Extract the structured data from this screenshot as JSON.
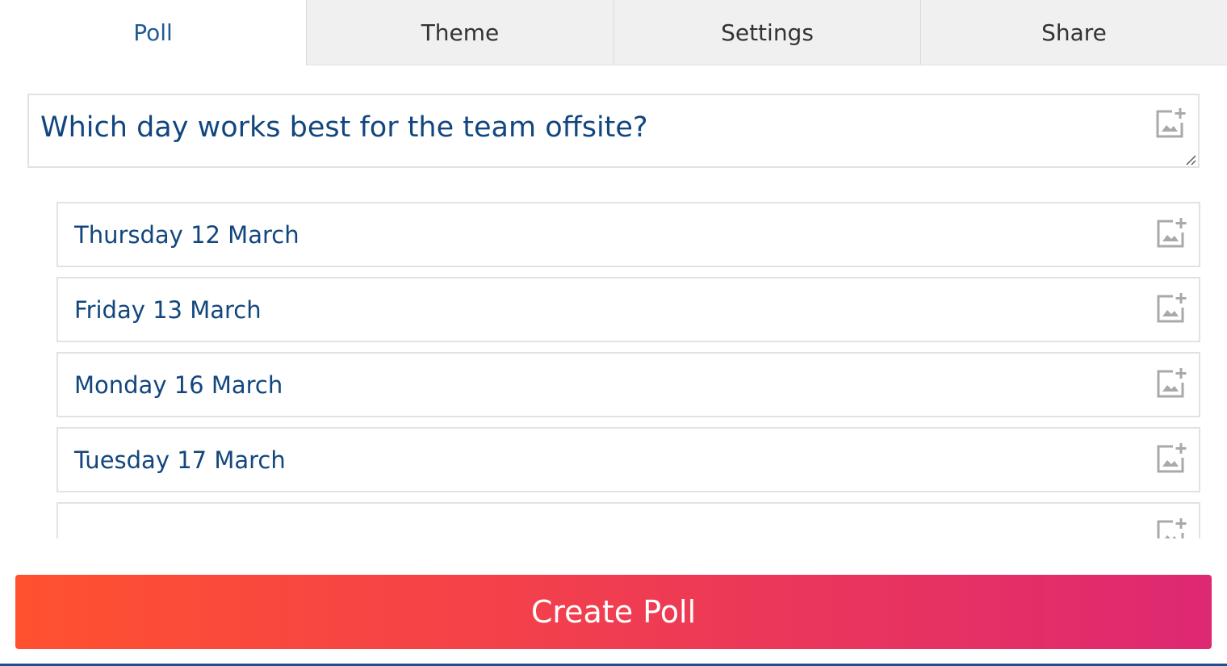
{
  "tabs": [
    {
      "label": "Poll",
      "active": true
    },
    {
      "label": "Theme",
      "active": false
    },
    {
      "label": "Settings",
      "active": false
    },
    {
      "label": "Share",
      "active": false
    }
  ],
  "question": {
    "text": "Which day works best for the team offsite?",
    "image_icon": "add-image-icon"
  },
  "options": [
    {
      "text": "Thursday 12 March"
    },
    {
      "text": "Friday 13 March"
    },
    {
      "text": "Monday 16 March"
    },
    {
      "text": "Tuesday 17 March"
    },
    {
      "text": ""
    }
  ],
  "create_button": {
    "label": "Create Poll"
  },
  "colors": {
    "accent_text": "#12467e",
    "active_tab_text": "#1f5a97",
    "tab_background": "#f0f0f0",
    "button_gradient_start": "#ff5130",
    "button_gradient_end": "#dd2872",
    "bottom_bar": "#1f4f8c"
  }
}
